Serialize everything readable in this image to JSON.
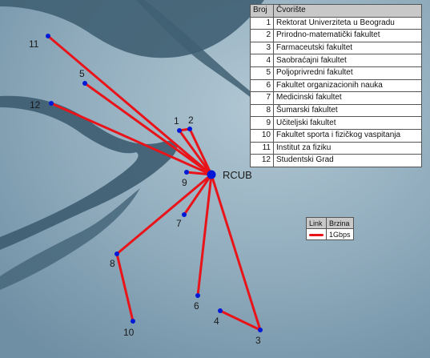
{
  "map": {
    "hub": {
      "label": "RCUB",
      "color": "#0019d6"
    },
    "link_color": "#e8141a",
    "node_color": "#0019d6",
    "nodes": [
      {
        "id": "1",
        "name": "Rektorat Univerziteta u Beogradu"
      },
      {
        "id": "2",
        "name": "Prirodno-matematički fakultet"
      },
      {
        "id": "3",
        "name": "Farmaceutski fakultet"
      },
      {
        "id": "4",
        "name": "Saobraćajni fakultet"
      },
      {
        "id": "5",
        "name": "Poljoprivredni fakultet"
      },
      {
        "id": "6",
        "name": "Fakultet organizacionih nauka"
      },
      {
        "id": "7",
        "name": "Medicinski fakultet"
      },
      {
        "id": "8",
        "name": "Šumarski fakultet"
      },
      {
        "id": "9",
        "name": "Učiteljski fakultet"
      },
      {
        "id": "10",
        "name": "Fakultet sporta i fizičkog vaspitanja"
      },
      {
        "id": "11",
        "name": "Institut za fiziku"
      },
      {
        "id": "12",
        "name": "Studentski Grad"
      }
    ],
    "links": [
      [
        "RCUB",
        "1"
      ],
      [
        "RCUB",
        "2"
      ],
      [
        "RCUB",
        "3"
      ],
      [
        "RCUB",
        "5"
      ],
      [
        "RCUB",
        "6"
      ],
      [
        "RCUB",
        "7"
      ],
      [
        "RCUB",
        "8"
      ],
      [
        "RCUB",
        "9"
      ],
      [
        "RCUB",
        "11"
      ],
      [
        "RCUB",
        "12"
      ],
      [
        "1",
        "2"
      ],
      [
        "3",
        "4"
      ],
      [
        "8",
        "10"
      ]
    ]
  },
  "table": {
    "header_num": "Broj",
    "header_name": "Čvorište"
  },
  "legend": {
    "header_link": "Link",
    "header_speed": "Brzina",
    "speed": "1Gbps",
    "color": "#e8141a"
  }
}
